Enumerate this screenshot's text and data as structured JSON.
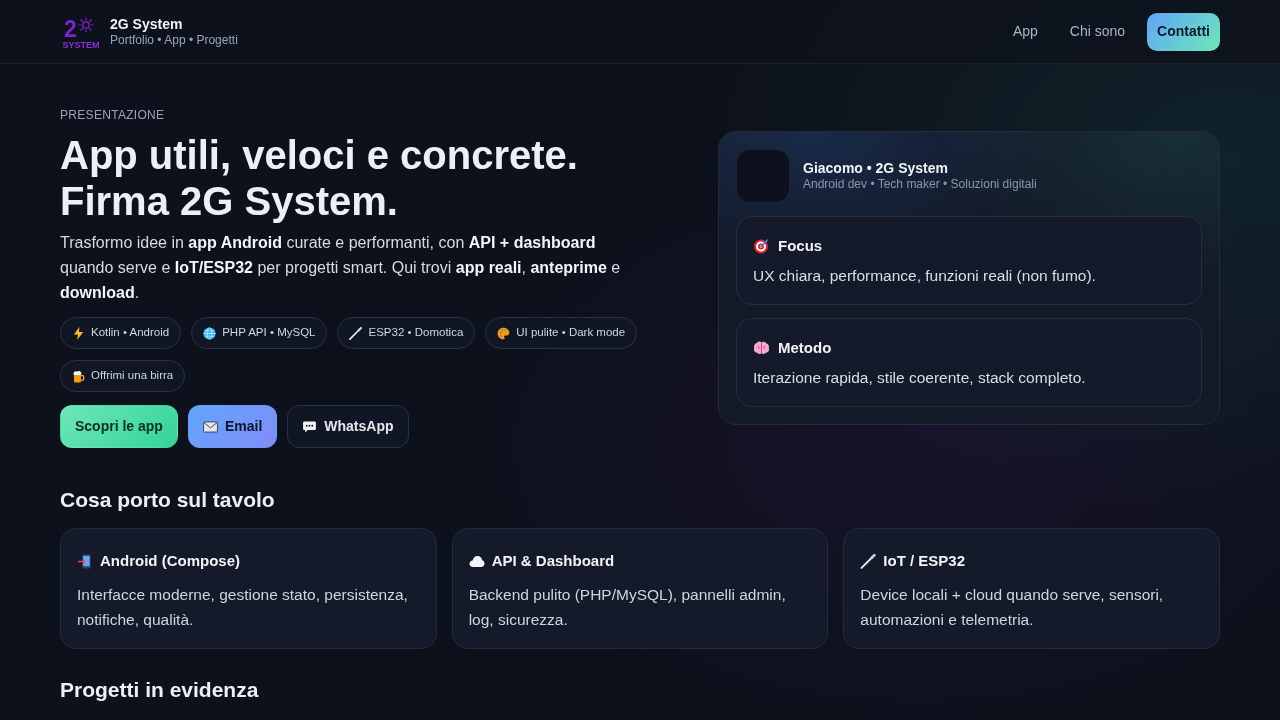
{
  "header": {
    "logo": {
      "mark": "2",
      "caption": "SYSTEM"
    },
    "brand": "2G System",
    "tagline": "Portfolio • App • Progetti",
    "nav": [
      {
        "label": "App",
        "kind": "link"
      },
      {
        "label": "Chi sono",
        "kind": "link"
      },
      {
        "label": "Contatti",
        "kind": "button"
      }
    ]
  },
  "hero": {
    "eyebrow": "PRESENTAZIONE",
    "title_lines": [
      "App utili, veloci e concrete.",
      "Firma 2G System."
    ],
    "intro": "Trasformo idee in **app Android** curate e performanti, con **API + dashboard** quando serve e **IoT/ESP32** per progetti smart. Qui trovi **app reali**, **anteprime** e **download**.",
    "chips": [
      "Kotlin • Android",
      "PHP API • MySQL",
      "ESP32 • Domotica",
      "UI pulite • Dark mode",
      "Offrimi una birra"
    ],
    "actions": [
      {
        "label": "Scopri le app",
        "kind": "primary"
      },
      {
        "label": "Email",
        "kind": "secondary"
      },
      {
        "label": "WhatsApp",
        "kind": "ghost"
      }
    ]
  },
  "profile_card": {
    "name": "Giacomo • 2G System",
    "subtitle": "Android dev • Tech maker • Soluzioni digitali",
    "items": [
      {
        "title": "Focus",
        "text": "UX chiara, performance, funzioni reali (non fumo)."
      },
      {
        "title": "Metodo",
        "text": "Iterazione rapida, stile coerente, stack completo."
      }
    ]
  },
  "skills": {
    "heading": "Cosa porto sul tavolo",
    "cards": [
      {
        "title": "Android (Compose)",
        "text": "Interfacce moderne, gestione stato, persistenza, notifiche, qualità."
      },
      {
        "title": "API & Dashboard",
        "text": "Backend pulito (PHP/MySQL), pannelli admin, log, sicurezza."
      },
      {
        "title": "IoT / ESP32",
        "text": "Device locali + cloud quando serve, sensori, automazioni e telemetria."
      }
    ]
  },
  "projects": {
    "heading": "Progetti in evidenza"
  }
}
